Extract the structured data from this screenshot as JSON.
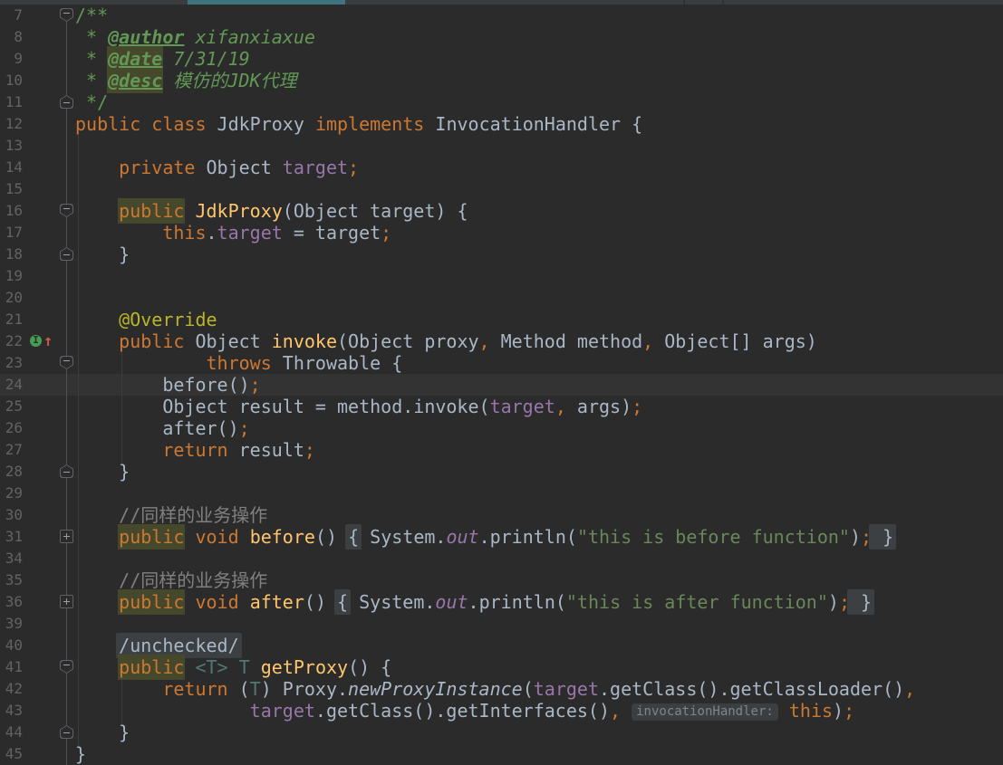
{
  "app": "intellij-editor",
  "topbar": {
    "active_tab_underline_color": "#3E7380",
    "strip_color": "#3A3D3F"
  },
  "palette": {
    "background": "#2B2B2B",
    "caret_line_background": "#333333",
    "keyword": "#CC7832",
    "default_text": "#A9B7C6",
    "method_declaration": "#FFC66D",
    "field": "#9876AA",
    "annotation": "#BBB529",
    "doc_comment": "#629755",
    "line_comment": "#808080",
    "string": "#6A8759",
    "type_parameter": "#507874",
    "identifier_highlight_background": "#46482B",
    "fold_background": "#3D4043",
    "inlay_hint_background": "#3C3F41",
    "inlay_hint_text": "#7F858D",
    "line_number": "#606366",
    "gutter_override_icon_green": "#499C54",
    "gutter_arrow_red": "#CF5B4C"
  },
  "editor": {
    "caret_line_number": "24",
    "gutter_icons": [
      {
        "line": "22",
        "name": "implements-method-icon"
      }
    ],
    "lines": [
      {
        "n": "7",
        "fold": "top",
        "segs": [
          {
            "c": "doc",
            "t": "/**"
          }
        ]
      },
      {
        "n": "8",
        "segs": [
          {
            "c": "doc",
            "t": " * "
          },
          {
            "c": "doctag",
            "t": "@author"
          },
          {
            "c": "docval",
            "t": " xifanxiaxue"
          }
        ]
      },
      {
        "n": "9",
        "segs": [
          {
            "c": "doc",
            "t": " * "
          },
          {
            "c": "doctag hl",
            "t": "@date"
          },
          {
            "c": "docval",
            "t": " 7/31/19"
          }
        ]
      },
      {
        "n": "10",
        "segs": [
          {
            "c": "doc",
            "t": " * "
          },
          {
            "c": "doctag hl",
            "t": "@desc"
          },
          {
            "c": "docval",
            "t": " 模仿的JDK代理"
          }
        ]
      },
      {
        "n": "11",
        "fold": "bottom",
        "segs": [
          {
            "c": "doc",
            "t": " */"
          }
        ]
      },
      {
        "n": "12",
        "segs": [
          {
            "c": "kw",
            "t": "public"
          },
          {
            "c": "pl",
            "t": " "
          },
          {
            "c": "kw",
            "t": "class"
          },
          {
            "c": "pl",
            "t": " JdkProxy "
          },
          {
            "c": "kw",
            "t": "implements"
          },
          {
            "c": "pl",
            "t": " InvocationHandler {"
          }
        ]
      },
      {
        "n": "13",
        "segs": []
      },
      {
        "n": "14",
        "segs": [
          {
            "c": "pl",
            "t": "    "
          },
          {
            "c": "kw",
            "t": "private"
          },
          {
            "c": "pl",
            "t": " Object "
          },
          {
            "c": "fld",
            "t": "target"
          },
          {
            "c": "sc",
            "t": ";"
          }
        ]
      },
      {
        "n": "15",
        "segs": []
      },
      {
        "n": "16",
        "fold": "top",
        "segs": [
          {
            "c": "pl",
            "t": "    "
          },
          {
            "c": "kw hl",
            "t": "public"
          },
          {
            "c": "pl",
            "t": " "
          },
          {
            "c": "decl",
            "t": "JdkProxy"
          },
          {
            "c": "pl",
            "t": "(Object target) {"
          }
        ]
      },
      {
        "n": "17",
        "segs": [
          {
            "c": "pl",
            "t": "        "
          },
          {
            "c": "kw",
            "t": "this"
          },
          {
            "c": "pl",
            "t": "."
          },
          {
            "c": "fld",
            "t": "target"
          },
          {
            "c": "pl",
            "t": " = target"
          },
          {
            "c": "sc",
            "t": ";"
          }
        ]
      },
      {
        "n": "18",
        "fold": "bottom",
        "segs": [
          {
            "c": "pl",
            "t": "    }"
          }
        ]
      },
      {
        "n": "19",
        "segs": []
      },
      {
        "n": "20",
        "segs": []
      },
      {
        "n": "21",
        "segs": [
          {
            "c": "pl",
            "t": "    "
          },
          {
            "c": "anno",
            "t": "@Override"
          }
        ]
      },
      {
        "n": "22",
        "icon": "override",
        "segs": [
          {
            "c": "pl",
            "t": "    "
          },
          {
            "c": "kw",
            "t": "public"
          },
          {
            "c": "pl",
            "t": " Object "
          },
          {
            "c": "decl",
            "t": "invoke"
          },
          {
            "c": "pl",
            "t": "(Object proxy"
          },
          {
            "c": "sc",
            "t": ","
          },
          {
            "c": "pl",
            "t": " Method method"
          },
          {
            "c": "sc",
            "t": ","
          },
          {
            "c": "pl",
            "t": " Object[] args)"
          }
        ]
      },
      {
        "n": "23",
        "fold": "top",
        "segs": [
          {
            "c": "pl",
            "t": "            "
          },
          {
            "c": "kw",
            "t": "throws"
          },
          {
            "c": "pl",
            "t": " Throwable {"
          }
        ]
      },
      {
        "n": "24",
        "caret": true,
        "segs": [
          {
            "c": "pl",
            "t": "        before()"
          },
          {
            "c": "sc",
            "t": ";"
          }
        ]
      },
      {
        "n": "25",
        "segs": [
          {
            "c": "pl",
            "t": "        Object result = method.invoke("
          },
          {
            "c": "fld",
            "t": "target"
          },
          {
            "c": "sc",
            "t": ","
          },
          {
            "c": "pl",
            "t": " args)"
          },
          {
            "c": "sc",
            "t": ";"
          }
        ]
      },
      {
        "n": "26",
        "segs": [
          {
            "c": "pl",
            "t": "        after()"
          },
          {
            "c": "sc",
            "t": ";"
          }
        ]
      },
      {
        "n": "27",
        "segs": [
          {
            "c": "pl",
            "t": "        "
          },
          {
            "c": "kw",
            "t": "return"
          },
          {
            "c": "pl",
            "t": " result"
          },
          {
            "c": "sc",
            "t": ";"
          }
        ]
      },
      {
        "n": "28",
        "fold": "bottom",
        "segs": [
          {
            "c": "pl",
            "t": "    }"
          }
        ]
      },
      {
        "n": "29",
        "segs": []
      },
      {
        "n": "30",
        "segs": [
          {
            "c": "cmt",
            "t": "    //同样的业务操作"
          }
        ]
      },
      {
        "n": "31",
        "fold": "plus",
        "segs": [
          {
            "c": "pl",
            "t": "    "
          },
          {
            "c": "kw hl",
            "t": "public"
          },
          {
            "c": "pl",
            "t": " "
          },
          {
            "c": "kw",
            "t": "void"
          },
          {
            "c": "pl",
            "t": " "
          },
          {
            "c": "decl",
            "t": "before"
          },
          {
            "c": "pl",
            "t": "() "
          },
          {
            "c": "fold",
            "t": "{"
          },
          {
            "c": "pl",
            "t": " System."
          },
          {
            "c": "fldi",
            "t": "out"
          },
          {
            "c": "pl",
            "t": ".println("
          },
          {
            "c": "str",
            "t": "\"this is before function\""
          },
          {
            "c": "pl",
            "t": ")"
          },
          {
            "c": "sc",
            "t": ";"
          },
          {
            "c": "fold",
            "t": " }"
          }
        ]
      },
      {
        "n": "34",
        "segs": []
      },
      {
        "n": "35",
        "segs": [
          {
            "c": "cmt",
            "t": "    //同样的业务操作"
          }
        ]
      },
      {
        "n": "36",
        "fold": "plus",
        "segs": [
          {
            "c": "pl",
            "t": "    "
          },
          {
            "c": "kw hl",
            "t": "public"
          },
          {
            "c": "pl",
            "t": " "
          },
          {
            "c": "kw",
            "t": "void"
          },
          {
            "c": "pl",
            "t": " "
          },
          {
            "c": "decl",
            "t": "after"
          },
          {
            "c": "pl",
            "t": "() "
          },
          {
            "c": "fold",
            "t": "{"
          },
          {
            "c": "pl",
            "t": " System."
          },
          {
            "c": "fldi",
            "t": "out"
          },
          {
            "c": "pl",
            "t": ".println("
          },
          {
            "c": "str",
            "t": "\"this is after function\""
          },
          {
            "c": "pl",
            "t": ")"
          },
          {
            "c": "sc",
            "t": ";"
          },
          {
            "c": "fold",
            "t": " }"
          }
        ]
      },
      {
        "n": "39",
        "segs": []
      },
      {
        "n": "40",
        "segs": [
          {
            "c": "pl",
            "t": "    "
          },
          {
            "c": "fold",
            "t": "/unchecked/"
          }
        ]
      },
      {
        "n": "41",
        "fold": "top",
        "segs": [
          {
            "c": "pl",
            "t": "    "
          },
          {
            "c": "kw hl",
            "t": "public"
          },
          {
            "c": "pl",
            "t": " "
          },
          {
            "c": "typ",
            "t": "<T>"
          },
          {
            "c": "pl",
            "t": " "
          },
          {
            "c": "typ",
            "t": "T"
          },
          {
            "c": "pl",
            "t": " "
          },
          {
            "c": "decl",
            "t": "getProxy"
          },
          {
            "c": "pl",
            "t": "() {"
          }
        ]
      },
      {
        "n": "42",
        "segs": [
          {
            "c": "pl",
            "t": "        "
          },
          {
            "c": "kw",
            "t": "return"
          },
          {
            "c": "pl",
            "t": " ("
          },
          {
            "c": "typ",
            "t": "T"
          },
          {
            "c": "pl",
            "t": ") Proxy."
          },
          {
            "c": "stm",
            "t": "newProxyInstance"
          },
          {
            "c": "pl",
            "t": "("
          },
          {
            "c": "fld",
            "t": "target"
          },
          {
            "c": "pl",
            "t": ".getClass().getClassLoader()"
          },
          {
            "c": "sc",
            "t": ","
          }
        ]
      },
      {
        "n": "43",
        "segs": [
          {
            "c": "pl",
            "t": "                "
          },
          {
            "c": "fld",
            "t": "target"
          },
          {
            "c": "pl",
            "t": ".getClass().getInterfaces()"
          },
          {
            "c": "sc",
            "t": ","
          },
          {
            "c": "pl",
            "t": " "
          },
          {
            "c": "hint",
            "t": "invocationHandler:"
          },
          {
            "c": "pl",
            "t": " "
          },
          {
            "c": "kw",
            "t": "this"
          },
          {
            "c": "pl",
            "t": ")"
          },
          {
            "c": "sc",
            "t": ";"
          }
        ]
      },
      {
        "n": "44",
        "fold": "bottom",
        "segs": [
          {
            "c": "pl",
            "t": "    }"
          }
        ]
      },
      {
        "n": "45",
        "segs": [
          {
            "c": "pl",
            "t": "}"
          }
        ]
      }
    ]
  }
}
